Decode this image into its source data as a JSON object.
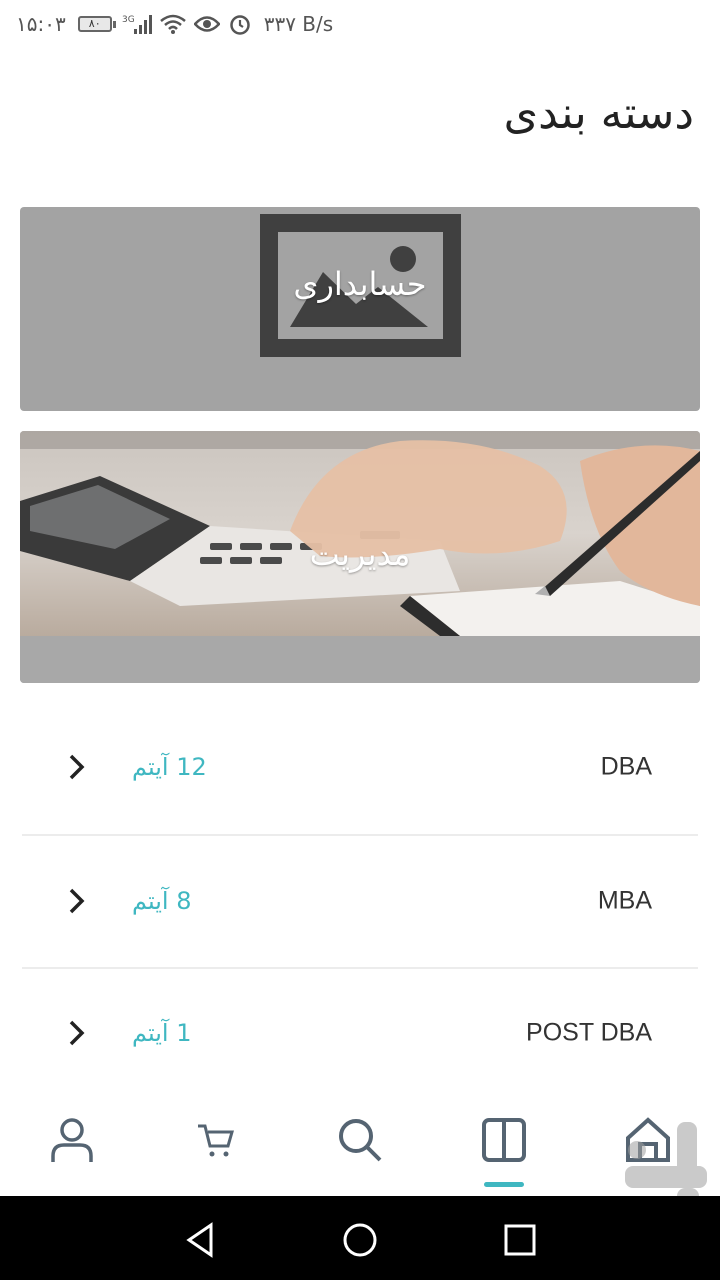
{
  "status_bar": {
    "time": "۱۵:۰۳",
    "battery": "۸۰",
    "network": "3G",
    "speed": "۳۳۷ B/s"
  },
  "header": {
    "title": "دسته بندی"
  },
  "categories": [
    {
      "label": "حسابداری",
      "image": "image-placeholder-icon"
    },
    {
      "label": "مدیریت",
      "image": "calculator-photo"
    }
  ],
  "list": [
    {
      "name": "DBA",
      "count": "12 آیتم"
    },
    {
      "name": "MBA",
      "count": "8 آیتم"
    },
    {
      "name": "POST DBA",
      "count": "1 آیتم"
    }
  ],
  "bottom_nav": {
    "items": [
      "profile-icon",
      "cart-icon",
      "search-icon",
      "categories-icon",
      "home-icon"
    ],
    "active": "categories-icon",
    "accent_color": "#3fb7c1"
  },
  "system_nav": [
    "back-icon",
    "home-circle-icon",
    "recents-icon"
  ]
}
